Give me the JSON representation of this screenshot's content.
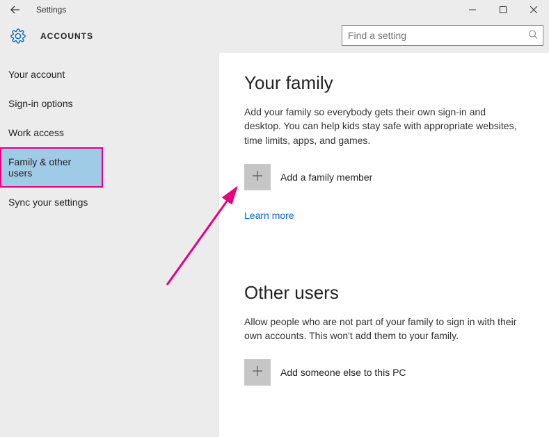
{
  "titlebar": {
    "title": "Settings",
    "back": "←",
    "minimize": "—",
    "maximize": "☐",
    "close": "✕"
  },
  "header": {
    "section": "ACCOUNTS",
    "search_placeholder": "Find a setting"
  },
  "sidebar": {
    "items": [
      {
        "label": "Your account"
      },
      {
        "label": "Sign-in options"
      },
      {
        "label": "Work access"
      },
      {
        "label": "Family & other users",
        "selected": true
      },
      {
        "label": "Sync your settings"
      }
    ]
  },
  "main": {
    "family": {
      "heading": "Your family",
      "desc": "Add your family so everybody gets their own sign-in and desktop. You can help kids stay safe with appropriate websites, time limits, apps, and games.",
      "add_label": "Add a family member",
      "learn_more": "Learn more"
    },
    "other": {
      "heading": "Other users",
      "desc": "Allow people who are not part of your family to sign in with their own accounts. This won't add them to your family.",
      "add_label": "Add someone else to this PC"
    }
  }
}
